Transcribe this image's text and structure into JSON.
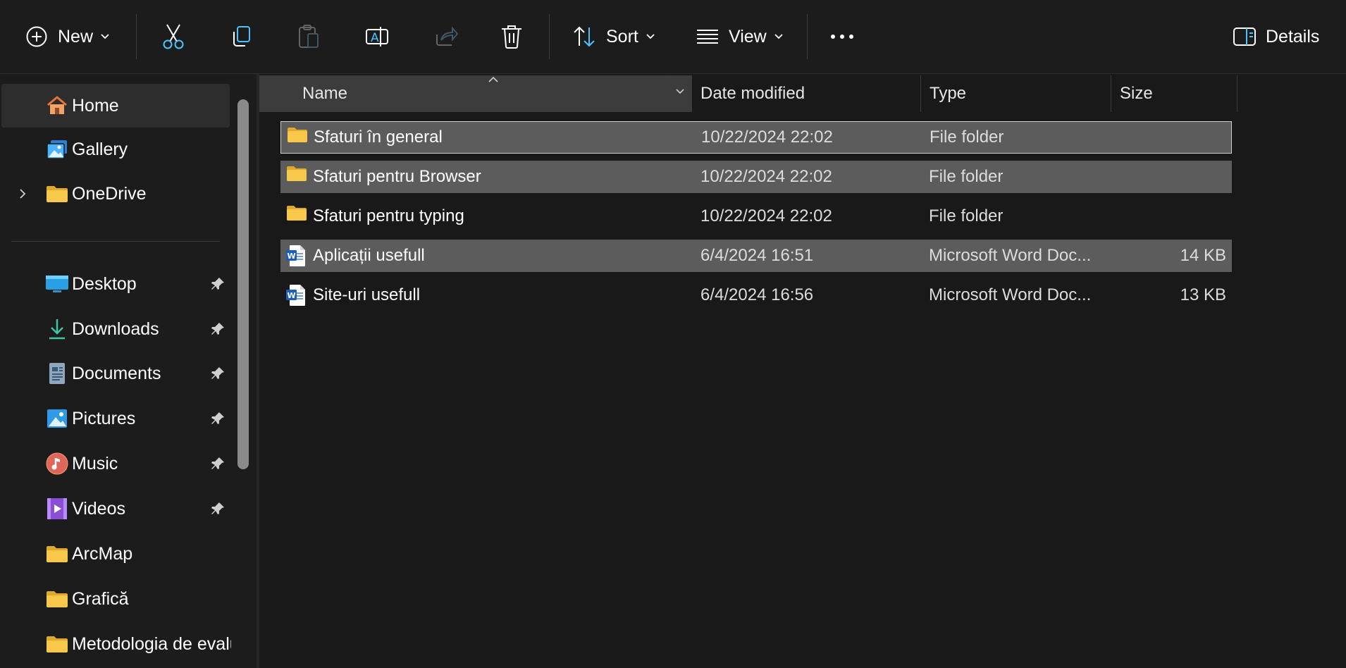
{
  "toolbar": {
    "new_label": "New",
    "sort_label": "Sort",
    "view_label": "View",
    "details_label": "Details",
    "icons": [
      "plus-circle-icon",
      "cut-icon",
      "copy-icon",
      "paste-icon",
      "rename-icon",
      "share-icon",
      "delete-icon",
      "sort-icon",
      "view-icon",
      "more-icon",
      "details-pane-icon"
    ]
  },
  "sidebar": {
    "quick": [
      {
        "label": "Home",
        "icon": "home-icon",
        "selected": true
      },
      {
        "label": "Gallery",
        "icon": "gallery-icon"
      },
      {
        "label": "OneDrive",
        "icon": "folder-icon",
        "expandable": true
      }
    ],
    "pinned": [
      {
        "label": "Desktop",
        "icon": "desktop-icon",
        "pinned": true
      },
      {
        "label": "Downloads",
        "icon": "download-icon",
        "pinned": true
      },
      {
        "label": "Documents",
        "icon": "documents-icon",
        "pinned": true
      },
      {
        "label": "Pictures",
        "icon": "pictures-icon",
        "pinned": true
      },
      {
        "label": "Music",
        "icon": "music-icon",
        "pinned": true
      },
      {
        "label": "Videos",
        "icon": "videos-icon",
        "pinned": true
      },
      {
        "label": "ArcMap",
        "icon": "folder-icon"
      },
      {
        "label": "Grafică",
        "icon": "folder-icon"
      },
      {
        "label": "Metodologia de evalu",
        "icon": "folder-icon"
      }
    ]
  },
  "columns": {
    "name": "Name",
    "date": "Date modified",
    "type": "Type",
    "size": "Size"
  },
  "files": [
    {
      "name": "Sfaturi în general",
      "date": "10/22/2024 22:02",
      "type": "File folder",
      "size": "",
      "icon": "folder-icon",
      "selected": true,
      "focused": true
    },
    {
      "name": "Sfaturi pentru Browser",
      "date": "10/22/2024 22:02",
      "type": "File folder",
      "size": "",
      "icon": "folder-icon",
      "selected": true
    },
    {
      "name": "Sfaturi pentru typing",
      "date": "10/22/2024 22:02",
      "type": "File folder",
      "size": "",
      "icon": "folder-icon",
      "selected": false
    },
    {
      "name": "Aplicații usefull",
      "date": "6/4/2024 16:51",
      "type": "Microsoft Word Doc...",
      "size": "14 KB",
      "icon": "word-doc-icon",
      "selected": true
    },
    {
      "name": "Site-uri usefull",
      "date": "6/4/2024 16:56",
      "type": "Microsoft Word Doc...",
      "size": "13 KB",
      "icon": "word-doc-icon",
      "selected": false
    }
  ],
  "colors": {
    "accent": "#4cc2ff",
    "folder": "#f8c84a",
    "selection": "#5c5c5c"
  }
}
